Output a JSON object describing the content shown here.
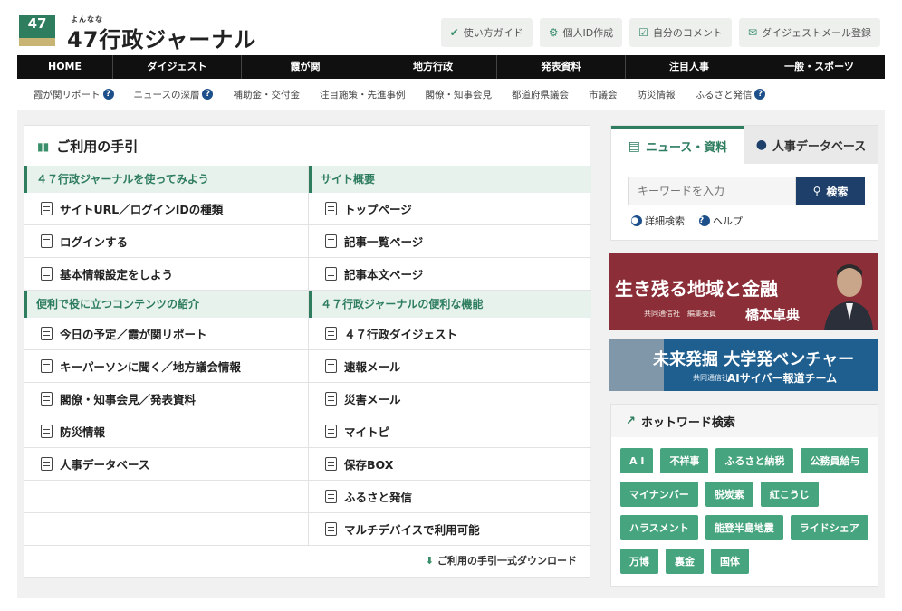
{
  "header": {
    "logo_box": "47",
    "logo_ruby": "よんなな",
    "site_title": "47行政ジャーナル",
    "buttons": [
      {
        "label": "使い方ガイド",
        "icon": "guide-icon"
      },
      {
        "label": "個人ID作成",
        "icon": "gear-icon"
      },
      {
        "label": "自分のコメント",
        "icon": "checkbox-icon"
      },
      {
        "label": "ダイジェストメール登録",
        "icon": "mail-icon"
      }
    ]
  },
  "main_nav": [
    "HOME",
    "ダイジェスト",
    "霞が関",
    "地方行政",
    "発表資料",
    "注目人事",
    "一般・スポーツ"
  ],
  "sub_nav": [
    {
      "label": "霞が関リポート",
      "help": true
    },
    {
      "label": "ニュースの深層",
      "help": true
    },
    {
      "label": "補助金・交付金",
      "help": false
    },
    {
      "label": "注目施策・先進事例",
      "help": false
    },
    {
      "label": "閣僚・知事会見",
      "help": false
    },
    {
      "label": "都道府県議会",
      "help": false
    },
    {
      "label": "市議会",
      "help": false
    },
    {
      "label": "防災情報",
      "help": false
    },
    {
      "label": "ふるさと発信",
      "help": true
    }
  ],
  "guide": {
    "title": "ご利用の手引",
    "left_sections": [
      {
        "heading": "４７行政ジャーナルを使ってみよう",
        "items": [
          "サイトURL／ログインIDの種類",
          "ログインする",
          "基本情報設定をしよう"
        ]
      },
      {
        "heading": "便利で役に立つコンテンツの紹介",
        "items": [
          "今日の予定／霞が関リポート",
          "キーパーソンに聞く／地方議会情報",
          "閣僚・知事会見／発表資料",
          "防災情報",
          "人事データベース"
        ]
      }
    ],
    "right_sections": [
      {
        "heading": "サイト概要",
        "items": [
          "トップページ",
          "記事一覧ページ",
          "記事本文ページ"
        ]
      },
      {
        "heading": "４７行政ジャーナルの便利な機能",
        "items": [
          "４７行政ダイジェスト",
          "速報メール",
          "災害メール",
          "マイトピ",
          "保存BOX",
          "ふるさと発信",
          "マルチデバイスで利用可能"
        ]
      }
    ],
    "download_label": "ご利用の手引一式ダウンロード"
  },
  "search_panel": {
    "tab_news": "ニュース・資料",
    "tab_people": "人事データベース",
    "placeholder": "キーワードを入力",
    "search_button": "検索",
    "advanced_search": "詳細検索",
    "help": "ヘルプ"
  },
  "banner1": {
    "title": "生き残る地域と金融",
    "sub": "共同通信社　編集委員",
    "name": "橋本卓典"
  },
  "banner2": {
    "title": "未来発掘 大学発ベンチャー",
    "sub": "共同通信社",
    "team": "AIサイバー報道チーム"
  },
  "hot_words": {
    "title": "ホットワード検索",
    "tags": [
      "A I",
      "不祥事",
      "ふるさと納税",
      "公務員給与",
      "マイナンバー",
      "脱炭素",
      "紅こうじ",
      "ハラスメント",
      "能登半島地震",
      "ライドシェア",
      "万博",
      "裏金",
      "国体"
    ]
  },
  "colors": {
    "accent_green": "#2e7d5e",
    "nav_black": "#101010",
    "search_navy": "#1d3f6a",
    "tag_green": "#46a57e"
  }
}
